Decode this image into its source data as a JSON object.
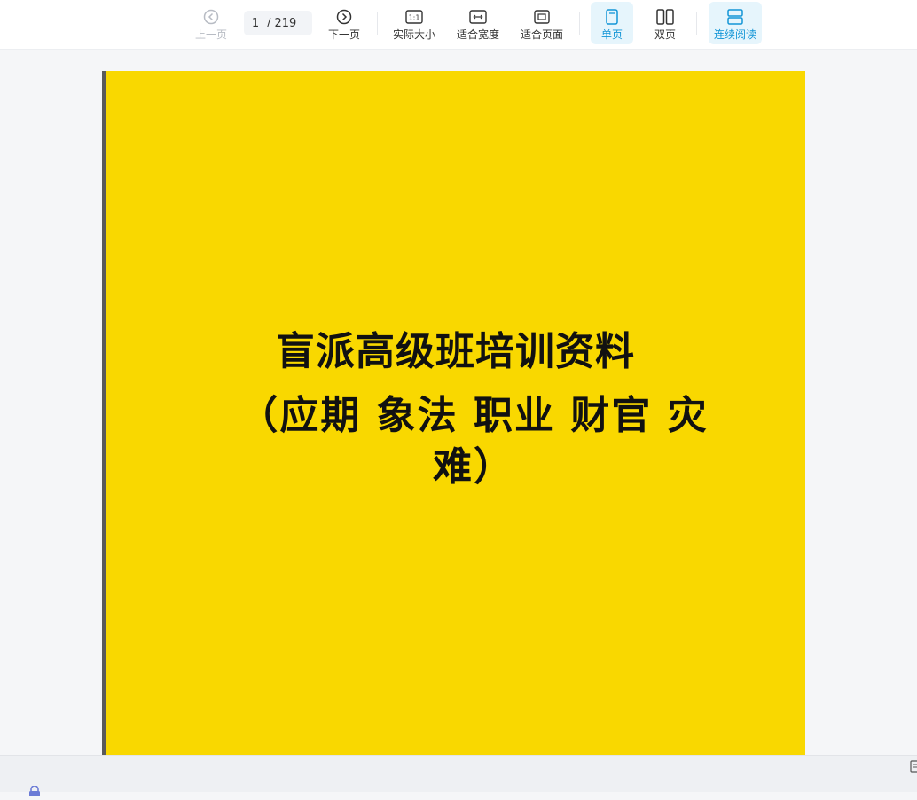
{
  "toolbar": {
    "prev_label": "上一页",
    "next_label": "下一页",
    "page_current": "1",
    "page_total": "/ 219",
    "actual_size_label": "实际大小",
    "actual_size_icon_text": "1:1",
    "fit_width_label": "适合宽度",
    "fit_page_label": "适合页面",
    "single_page_label": "单页",
    "double_page_label": "双页",
    "continuous_label": "连续阅读",
    "icons": {
      "prev": "chevron-left-circle-icon",
      "next": "chevron-right-circle-icon",
      "actual_size": "one-to-one-icon",
      "fit_width": "fit-width-icon",
      "fit_page": "fit-page-icon",
      "single_page": "single-page-icon",
      "double_page": "double-page-icon",
      "continuous": "continuous-scroll-icon"
    },
    "active_modes": [
      "single_page",
      "continuous"
    ]
  },
  "document": {
    "cover_title": "盲派高级班培训资料",
    "cover_subtitle": "（应期  象法  职业  财官  灾难）"
  },
  "colors": {
    "accent": "#1295d6",
    "active_bg": "#e6f5fc",
    "disabled": "#b8bcc4",
    "cover_background": "#f9d800",
    "cover_text": "#111111",
    "viewer_background": "#f5f6f8"
  }
}
